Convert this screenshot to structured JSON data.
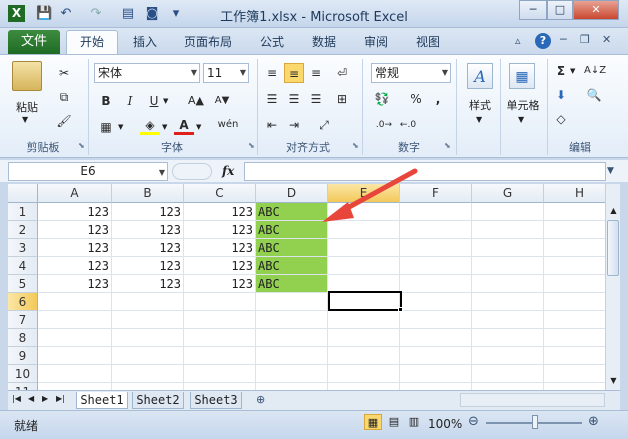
{
  "window": {
    "title": "工作簿1.xlsx - Microsoft Excel",
    "min": "─",
    "max": "□",
    "close": "✕"
  },
  "quick_access": {
    "save": "💾",
    "undo": "↶",
    "redo": "↷"
  },
  "tabs": {
    "file": "文件",
    "items": [
      "开始",
      "插入",
      "页面布局",
      "公式",
      "数据",
      "审阅",
      "视图"
    ],
    "help": "?"
  },
  "ribbon": {
    "clipboard": {
      "label": "剪贴板",
      "paste": "粘贴"
    },
    "font": {
      "label": "字体",
      "font_name": "宋体",
      "font_size": "11",
      "bold": "B",
      "italic": "I",
      "underline": "U",
      "grow": "A▲",
      "shrink": "A▼",
      "wen": "wén"
    },
    "alignment": {
      "label": "对齐方式"
    },
    "number": {
      "label": "数字",
      "format": "常规",
      "percent": "%",
      "comma": ","
    },
    "styles": {
      "label": "样式"
    },
    "cells": {
      "label": "单元格"
    },
    "editing": {
      "label": "编辑",
      "sum": "Σ"
    }
  },
  "formula_bar": {
    "name_box": "E6",
    "fx": "fx",
    "content": ""
  },
  "grid": {
    "columns": [
      "A",
      "B",
      "C",
      "D",
      "E",
      "F",
      "G",
      "H"
    ],
    "rows": [
      "1",
      "2",
      "3",
      "4",
      "5",
      "6",
      "7",
      "8",
      "9",
      "10",
      "11"
    ],
    "data": [
      [
        "123",
        "123",
        "123",
        "ABC"
      ],
      [
        "123",
        "123",
        "123",
        "ABC"
      ],
      [
        "123",
        "123",
        "123",
        "ABC"
      ],
      [
        "123",
        "123",
        "123",
        "ABC"
      ],
      [
        "123",
        "123",
        "123",
        "ABC"
      ]
    ],
    "highlight_color": "#92d050"
  },
  "sheets": [
    "Sheet1",
    "Sheet2",
    "Sheet3"
  ],
  "status": {
    "ready": "就绪",
    "zoom": "100%"
  },
  "annotation": {
    "arrow_color": "#e8463a"
  }
}
